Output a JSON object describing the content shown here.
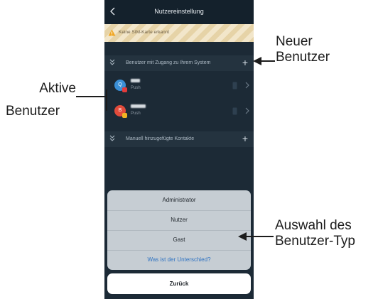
{
  "header": {
    "title": "Nutzereinstellung"
  },
  "warning": {
    "text": "Keine SIM-Karte erkannt"
  },
  "sections": {
    "users": {
      "label": "Benutzer mit Zugang zu Ihrem System"
    },
    "contacts": {
      "label": "Manuell hinzugefügte Kontakte"
    }
  },
  "users": [
    {
      "initial": "Q",
      "sub": "Push",
      "avatar_color": "#3a8fd6",
      "badge_color": "#e23b3b"
    },
    {
      "initial": "B",
      "sub": "Push",
      "avatar_color": "#e24b3b",
      "badge_color": "#f0b323"
    }
  ],
  "sheet": {
    "options": [
      "Administrator",
      "Nutzer",
      "Gast"
    ],
    "link": "Was ist der Unterschied?"
  },
  "back_button": "Zurück",
  "annotations": {
    "new_user": [
      "Neuer",
      "Benutzer"
    ],
    "active_users": [
      "Aktive",
      "Benutzer"
    ],
    "user_type": [
      "Auswahl des",
      "Benutzer-Typ"
    ]
  },
  "colors": {
    "accent_link": "#2f73c2",
    "warning_icon": "#f0a623",
    "background": "#1c2a36"
  },
  "icons": {
    "back": "chevron-left-icon",
    "warning": "warning-triangle-icon",
    "section": "double-chevron-down-icon",
    "add": "plus-icon",
    "device": "phone-icon",
    "row_action": "chevron-right-icon"
  }
}
